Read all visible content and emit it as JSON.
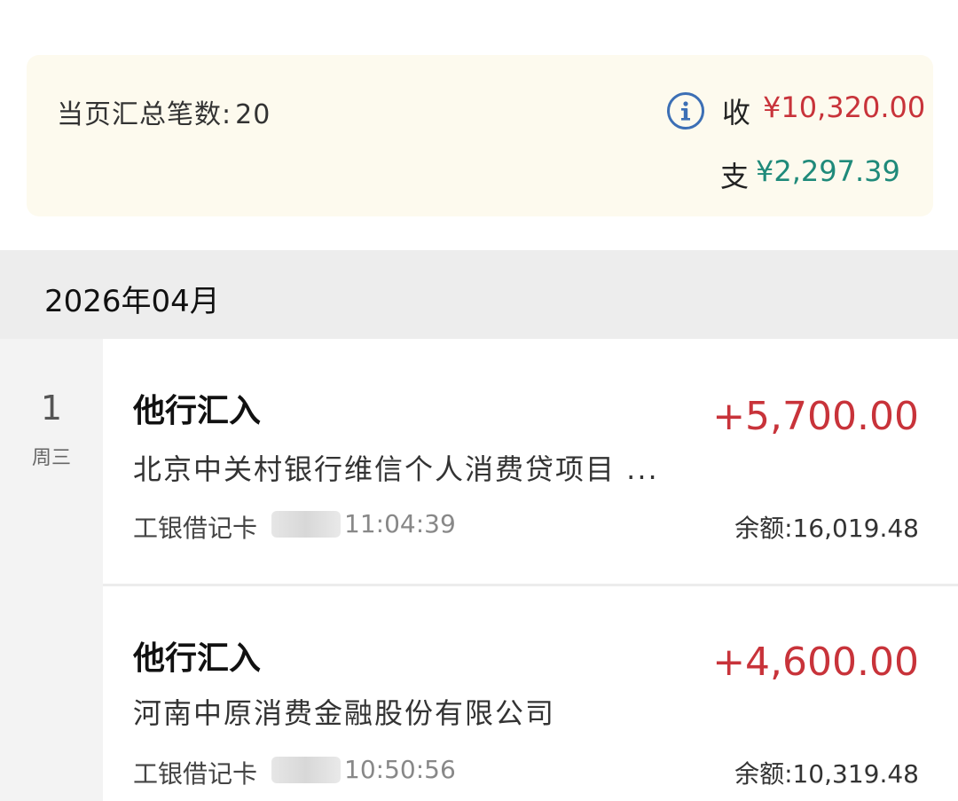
{
  "summary": {
    "count_label": "当页汇总笔数:",
    "count_value": "20",
    "info_icon": "info-circle-icon",
    "income_label": "收",
    "income_amount": "¥10,320.00",
    "expense_label": "支",
    "expense_amount": "¥2,297.39"
  },
  "month": "2026年04月",
  "day": {
    "date": "1",
    "weekday": "周三"
  },
  "transactions": [
    {
      "title": "他行汇入",
      "amount": "+5,700.00",
      "description": "北京中关村银行维信个人消费贷项目 ...",
      "card": "工银借记卡",
      "time": "11:04:39",
      "balance": "余额:16,019.48"
    },
    {
      "title": "他行汇入",
      "amount": "+4,600.00",
      "description": "河南中原消费金融股份有限公司",
      "card": "工银借记卡",
      "time": "10:50:56",
      "balance": "余额:10,319.48"
    }
  ],
  "colors": {
    "income": "#c8333a",
    "expense": "#1f8a7a",
    "summary_bg": "#fdfaee",
    "month_bar_bg": "#ededed",
    "info_icon": "#3c6fb5"
  }
}
